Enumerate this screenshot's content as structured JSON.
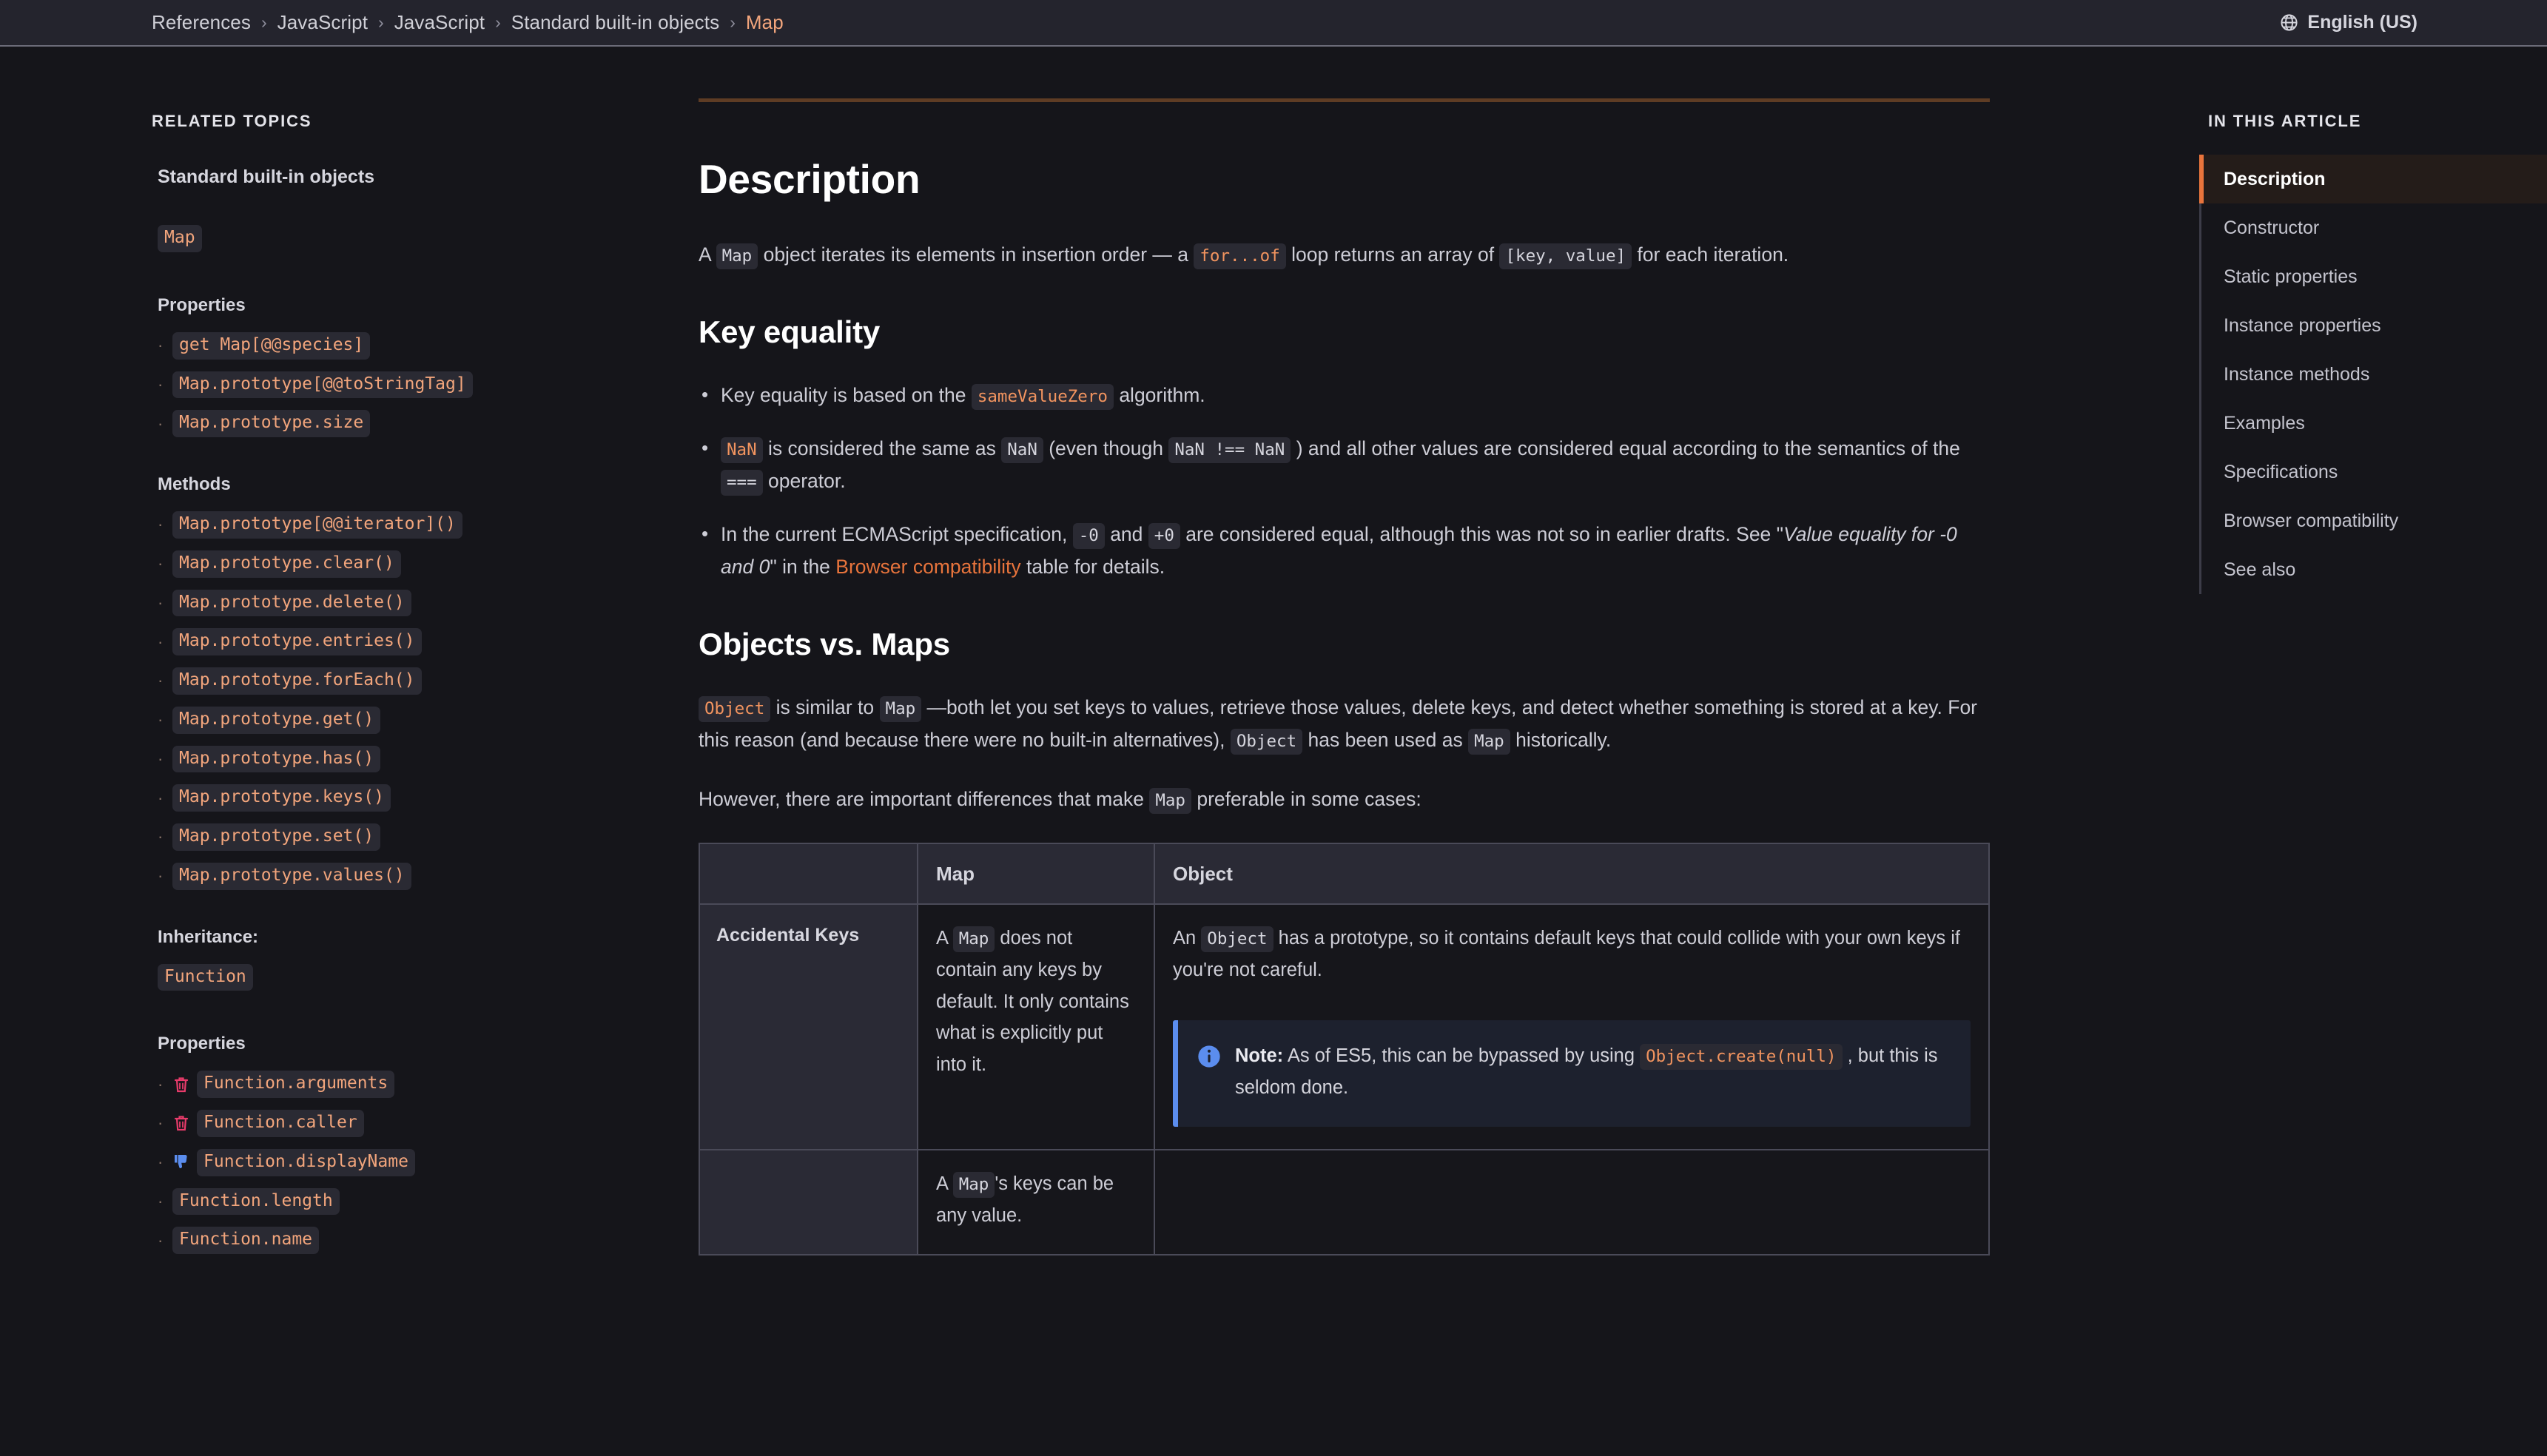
{
  "header": {
    "breadcrumb": [
      {
        "label": "References",
        "current": false
      },
      {
        "label": "JavaScript",
        "current": false
      },
      {
        "label": "JavaScript",
        "current": false
      },
      {
        "label": "Standard built-in objects",
        "current": false
      },
      {
        "label": "Map",
        "current": true
      }
    ],
    "separator": "›",
    "language": {
      "label": "English (US)",
      "icon": "globe-icon"
    }
  },
  "sidebar_left": {
    "kicker": "RELATED TOPICS",
    "group_title": "Standard built-in objects",
    "current_page_pill": "Map",
    "properties_title": "Properties",
    "properties": [
      {
        "label": "get Map[@@species]",
        "status": ""
      },
      {
        "label": "Map.prototype[@@toStringTag]",
        "status": ""
      },
      {
        "label": "Map.prototype.size",
        "status": ""
      }
    ],
    "methods_title": "Methods",
    "methods": [
      {
        "label": "Map.prototype[@@iterator]()",
        "status": ""
      },
      {
        "label": "Map.prototype.clear()",
        "status": ""
      },
      {
        "label": "Map.prototype.delete()",
        "status": ""
      },
      {
        "label": "Map.prototype.entries()",
        "status": ""
      },
      {
        "label": "Map.prototype.forEach()",
        "status": ""
      },
      {
        "label": "Map.prototype.get()",
        "status": ""
      },
      {
        "label": "Map.prototype.has()",
        "status": ""
      },
      {
        "label": "Map.prototype.keys()",
        "status": ""
      },
      {
        "label": "Map.prototype.set()",
        "status": ""
      },
      {
        "label": "Map.prototype.values()",
        "status": ""
      }
    ],
    "inheritance_title": "Inheritance:",
    "inheritance_pill": "Function",
    "fn_properties_title": "Properties",
    "fn_properties": [
      {
        "label": "Function.arguments",
        "status": "deprecated"
      },
      {
        "label": "Function.caller",
        "status": "deprecated"
      },
      {
        "label": "Function.displayName",
        "status": "non-standard"
      },
      {
        "label": "Function.length",
        "status": ""
      },
      {
        "label": "Function.name",
        "status": ""
      }
    ]
  },
  "article": {
    "heading": "Description",
    "intro": {
      "p1_a": "A ",
      "p1_code1": "Map",
      "p1_b": " object iterates its elements in insertion order — a ",
      "p1_code2": "for...of",
      "p1_c": " loop returns an array of ",
      "p1_code3": "[key, value]",
      "p1_d": " for each iteration."
    },
    "key_equality": {
      "heading": "Key equality",
      "b1_a": "Key equality is based on the ",
      "b1_code": "sameValueZero",
      "b1_b": " algorithm.",
      "b2_code1": "NaN",
      "b2_a": " is considered the same as ",
      "b2_code2": "NaN",
      "b2_b": " (even though ",
      "b2_code3": "NaN !== NaN",
      "b2_c": " ) and all other values are considered equal according to the semantics of the ",
      "b2_code4": "===",
      "b2_d": " operator.",
      "b3_a": "In the current ECMAScript specification, ",
      "b3_code1": "-0",
      "b3_b": " and ",
      "b3_code2": "+0",
      "b3_c": " are considered equal, although this was not so in earlier drafts. See \"",
      "b3_em": "Value equality for -0 and 0",
      "b3_d": "\" in the ",
      "b3_link": "Browser compatibility",
      "b3_e": " table for details."
    },
    "objects_vs_maps": {
      "heading": "Objects vs. Maps",
      "p1_code1": "Object",
      "p1_a": " is similar to ",
      "p1_code2": "Map",
      "p1_b": " —both let you set keys to values, retrieve those values, delete keys, and detect whether something is stored at a key. For this reason (and because there were no built-in alternatives), ",
      "p1_code3": "Object",
      "p1_c": " has been used as ",
      "p1_code4": "Map",
      "p1_d": " historically.",
      "p2_a": "However, there are important differences that make ",
      "p2_code": "Map",
      "p2_b": " preferable in some cases:"
    },
    "table": {
      "columns": [
        "",
        "Map",
        "Object"
      ],
      "rows": [
        {
          "label": "Accidental Keys",
          "map_a": "A ",
          "map_code": "Map",
          "map_b": " does not contain any keys by default. It only contains what is explicitly put into it.",
          "obj_a": "An ",
          "obj_code": "Object",
          "obj_b": " has a prototype, so it contains default keys that could collide with your own keys if you're not careful.",
          "note": {
            "label": "Note:",
            "text_a": " As of ES5, this can be bypassed by using ",
            "code": "Object.create(null)",
            "text_b": " , but this is seldom done.",
            "icon": "info-icon"
          }
        },
        {
          "label": "",
          "map_a": "A ",
          "map_code": "Map",
          "map_b": "'s keys can be any value.",
          "obj_a": "",
          "obj_code": "",
          "obj_b": ""
        }
      ]
    }
  },
  "sidebar_right": {
    "kicker": "IN THIS ARTICLE",
    "items": [
      {
        "label": "Description",
        "active": true
      },
      {
        "label": "Constructor",
        "active": false
      },
      {
        "label": "Static properties",
        "active": false
      },
      {
        "label": "Instance properties",
        "active": false
      },
      {
        "label": "Instance methods",
        "active": false
      },
      {
        "label": "Examples",
        "active": false
      },
      {
        "label": "Specifications",
        "active": false
      },
      {
        "label": "Browser compatibility",
        "active": false
      },
      {
        "label": "See also",
        "active": false
      }
    ]
  },
  "colors": {
    "page_bg": "#15151a",
    "header_bg": "#24242d",
    "accent_orange": "#e8743c",
    "code_accent": "#f2a57c",
    "deprecated": "#e83b6a",
    "nonstandard": "#5b8dee",
    "rule": "#5e3c24"
  }
}
